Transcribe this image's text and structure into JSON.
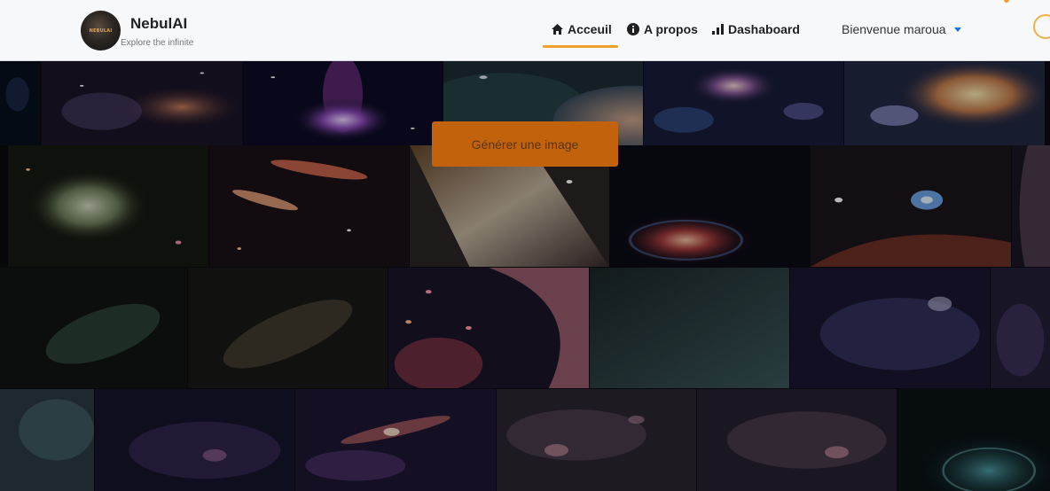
{
  "brand": {
    "name": "NebulAI",
    "tagline": "Explore the infinite",
    "logo_text": "NEBULAI"
  },
  "nav": {
    "links": [
      {
        "label": "Acceuil",
        "icon": "home-icon",
        "active": true
      },
      {
        "label": "A propos",
        "icon": "info-icon",
        "active": false
      },
      {
        "label": "Dashaboard",
        "icon": "bar-chart-icon",
        "active": false
      }
    ],
    "user_greeting": "Bienvenue maroua"
  },
  "main": {
    "generate_button": "Générer une image"
  },
  "colors": {
    "accent": "#f0a030",
    "button_bg": "#c2620d",
    "navbar_bg": "#f7f8fa",
    "link_blue": "#1a6fd0"
  }
}
